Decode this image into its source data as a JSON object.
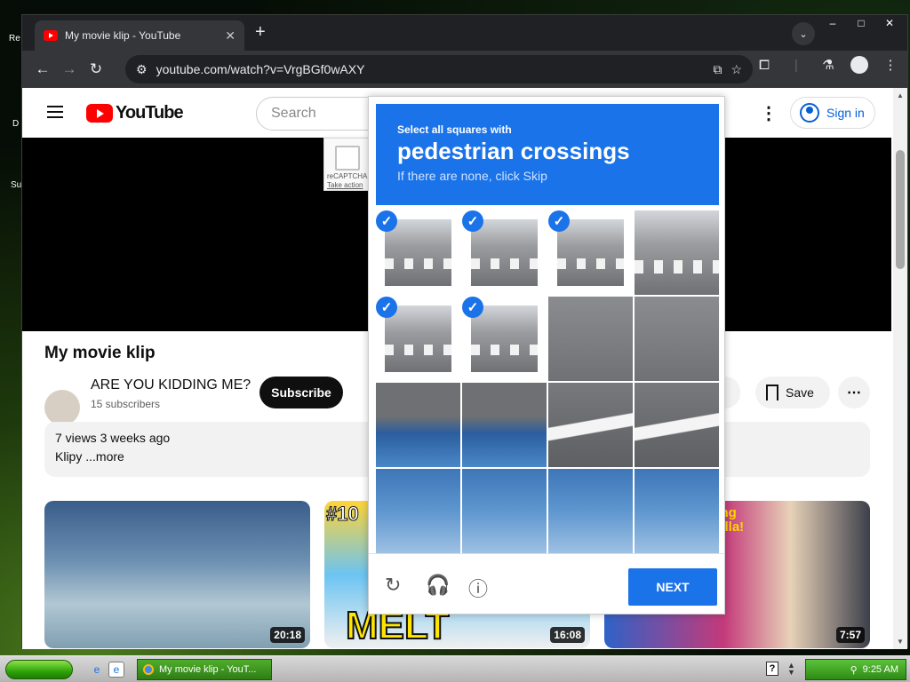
{
  "desktop": {
    "labels": [
      "Re",
      "D",
      "Su"
    ]
  },
  "browser": {
    "tab_title": "My movie klip - YouTube",
    "new_tab": "+",
    "url": "youtube.com/watch?v=VrgBGf0wAXY",
    "window_controls": {
      "minimize": "–",
      "maximize": "□",
      "close": "✕"
    }
  },
  "youtube": {
    "logo_text": "YouTube",
    "search_placeholder": "Search",
    "signin_label": "Sign in",
    "video_title": "My movie klip",
    "channel_name": "ARE YOU KIDDING ME?",
    "subscribers": "15 subscribers",
    "subscribe_label": "Subscribe",
    "save_label": "Save",
    "description": {
      "stats": "7 views  3 weeks ago",
      "text": "Klipy ...more"
    },
    "recommended": [
      {
        "duration": "20:18"
      },
      {
        "duration": "16:08",
        "overlay_text": "MELT",
        "number": "#10"
      },
      {
        "duration": "7:57",
        "overlay_text": "sing\npella!"
      }
    ]
  },
  "recaptcha_anchor": {
    "label": "reCAPTCHA",
    "sub_label": "Take action"
  },
  "challenge": {
    "instruction_small": "Select all squares with",
    "instruction_target": "pedestrian crossings",
    "instruction_hint": "If there are none, click Skip",
    "next_label": "NEXT",
    "tiles": [
      {
        "selected": true
      },
      {
        "selected": true
      },
      {
        "selected": true
      },
      {
        "selected": false
      },
      {
        "selected": true
      },
      {
        "selected": true
      },
      {
        "selected": false
      },
      {
        "selected": false
      },
      {
        "selected": false
      },
      {
        "selected": false
      },
      {
        "selected": false
      },
      {
        "selected": false
      },
      {
        "selected": false
      },
      {
        "selected": false
      },
      {
        "selected": false
      },
      {
        "selected": false
      }
    ]
  },
  "taskbar": {
    "active_window": "My movie klip - YouT...",
    "clock": "9:25 AM"
  },
  "colors": {
    "recaptcha_blue": "#1a73e8",
    "youtube_red": "#ff0000",
    "xp_green": "#2f8a15"
  }
}
